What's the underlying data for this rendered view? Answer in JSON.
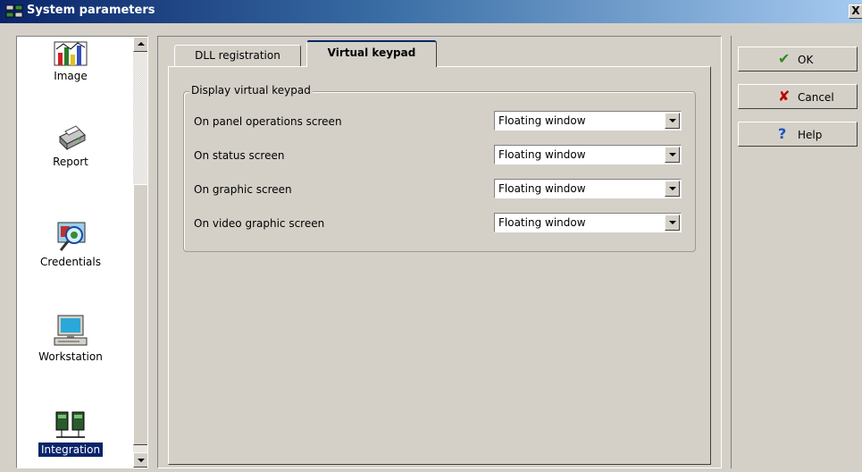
{
  "window": {
    "title": "System parameters",
    "close_label": "X"
  },
  "sidebar": {
    "items": [
      {
        "label": "Image",
        "icon": "image-chart-icon"
      },
      {
        "label": "Report",
        "icon": "printer-icon"
      },
      {
        "label": "Credentials",
        "icon": "credentials-magnifier-icon"
      },
      {
        "label": "Workstation",
        "icon": "computer-icon"
      },
      {
        "label": "Integration",
        "icon": "network-panels-icon",
        "selected": true
      }
    ]
  },
  "tabs": [
    {
      "label": "DLL registration",
      "active": false
    },
    {
      "label": "Virtual keypad",
      "active": true
    }
  ],
  "group": {
    "title": "Display virtual keypad",
    "rows": [
      {
        "label": "On panel operations screen",
        "value": "Floating window"
      },
      {
        "label": "On status screen",
        "value": "Floating window"
      },
      {
        "label": "On graphic screen",
        "value": "Floating window"
      },
      {
        "label": "On video graphic screen",
        "value": "Floating window"
      }
    ]
  },
  "buttons": {
    "ok": "OK",
    "cancel": "Cancel",
    "help": "Help"
  },
  "colors": {
    "accent": "#0a246a",
    "ok": "#2e8b1e",
    "cancel": "#c00000",
    "help": "#1c4fc0"
  }
}
